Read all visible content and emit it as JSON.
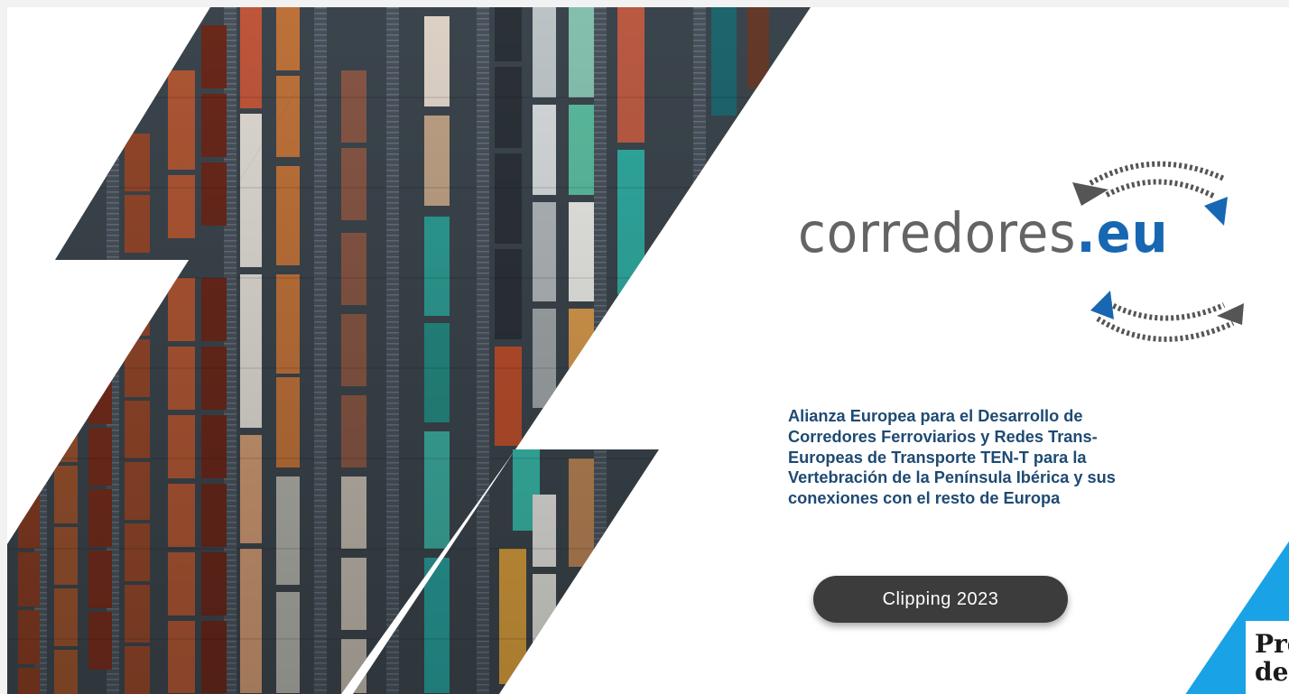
{
  "logo": {
    "name_main": "corredores",
    "name_accent": ".eu",
    "color_gray": "#646464",
    "color_blue": "#1767b2"
  },
  "tagline": {
    "lines": [
      "Alianza Europea para el Desarrollo de",
      "Corredores Ferroviarios y Redes Trans-",
      "Europeas de Transporte TEN-T para la",
      "Vertebración de la Península Ibérica y sus",
      "conexiones con el resto de Europa"
    ],
    "color": "#1e4a73"
  },
  "button": {
    "label": "Clipping 2023"
  },
  "corner": {
    "line1": "Pre",
    "line2": "de f",
    "accent_color": "#1aa2e6"
  },
  "image": {
    "subject": "aerial-view-of-freight-trains-on-rail-tracks"
  }
}
